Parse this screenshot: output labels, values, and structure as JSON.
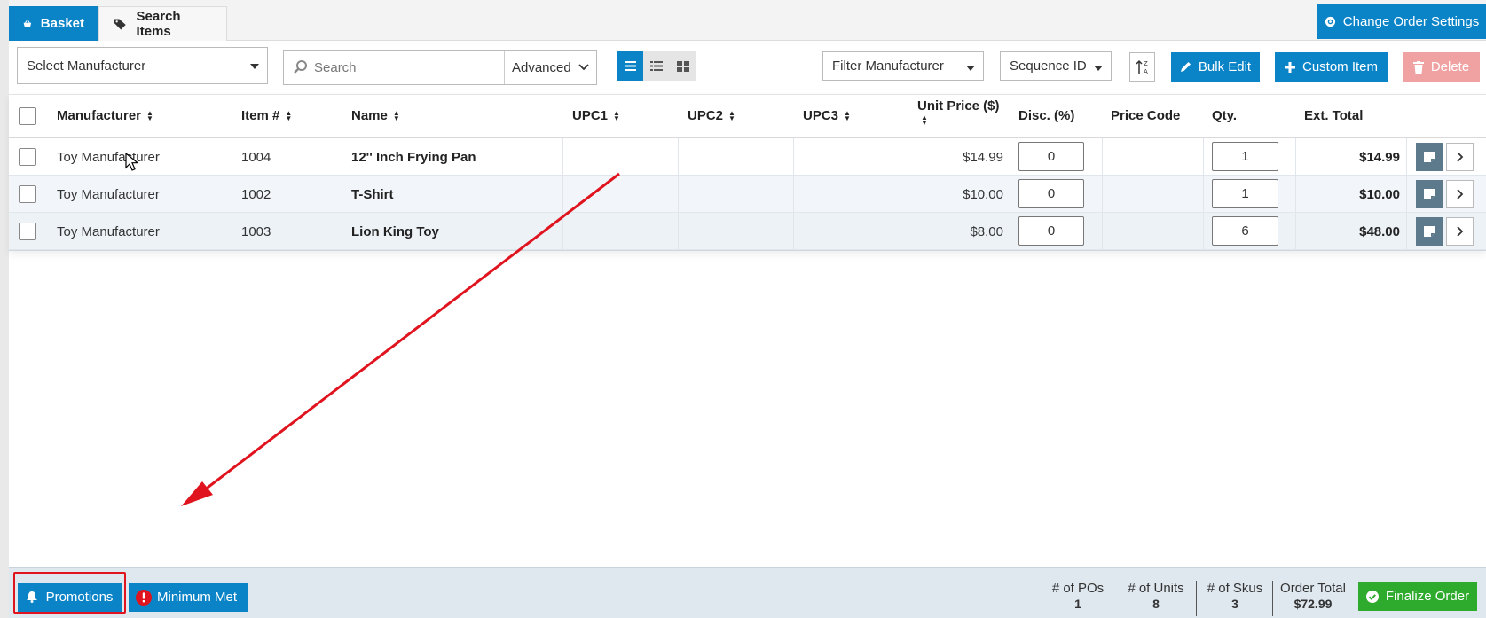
{
  "tabs": [
    {
      "label": "Basket",
      "icon": "basket-icon",
      "active": true
    },
    {
      "label": "Search Items",
      "icon": "tags-icon",
      "active": false
    }
  ],
  "header": {
    "settings_label": "Change Order Settings",
    "settings_icon": "gear-icon"
  },
  "toolbar": {
    "manufacturer_select": "Select Manufacturer",
    "search_placeholder": "Search",
    "advanced_label": "Advanced",
    "view_modes": [
      "list-view-icon",
      "detail-view-icon",
      "grid-view-icon"
    ],
    "active_view": "list-view-icon",
    "filter_manufacturer": "Filter Manufacturer",
    "sequence_select": "Sequence ID",
    "bulk_edit_label": "Bulk Edit",
    "custom_item_label": "Custom Item",
    "delete_label": "Delete"
  },
  "table": {
    "columns": [
      "Manufacturer",
      "Item #",
      "Name",
      "UPC1",
      "UPC2",
      "UPC3",
      "Unit Price ($)",
      "Disc. (%)",
      "Price Code",
      "Qty.",
      "Ext. Total"
    ],
    "rows": [
      {
        "manufacturer": "Toy Manufacturer",
        "item": "1004",
        "name": "12'' Inch Frying Pan",
        "upc1": "",
        "upc2": "",
        "upc3": "",
        "unit_price": "$14.99",
        "disc": "0",
        "price_code": "",
        "qty": "1",
        "ext_total": "$14.99"
      },
      {
        "manufacturer": "Toy Manufacturer",
        "item": "1002",
        "name": "T-Shirt",
        "upc1": "",
        "upc2": "",
        "upc3": "",
        "unit_price": "$10.00",
        "disc": "0",
        "price_code": "",
        "qty": "1",
        "ext_total": "$10.00"
      },
      {
        "manufacturer": "Toy Manufacturer",
        "item": "1003",
        "name": "Lion King Toy",
        "upc1": "",
        "upc2": "",
        "upc3": "",
        "unit_price": "$8.00",
        "disc": "0",
        "price_code": "",
        "qty": "6",
        "ext_total": "$48.00"
      }
    ]
  },
  "footer": {
    "promotions_label": "Promotions",
    "minimum_label": "Minimum Met",
    "stats": [
      {
        "label": "# of POs",
        "value": "1"
      },
      {
        "label": "# of Units",
        "value": "8"
      },
      {
        "label": "# of Skus",
        "value": "3"
      },
      {
        "label": "Order Total",
        "value": "$72.99"
      }
    ],
    "finalize_label": "Finalize Order"
  },
  "colors": {
    "primary": "#0b84c7",
    "success": "#2eaa2c",
    "delete": "#f0a1a1",
    "annotation": "#e0141e",
    "footer_bg": "#dfe7ef"
  }
}
